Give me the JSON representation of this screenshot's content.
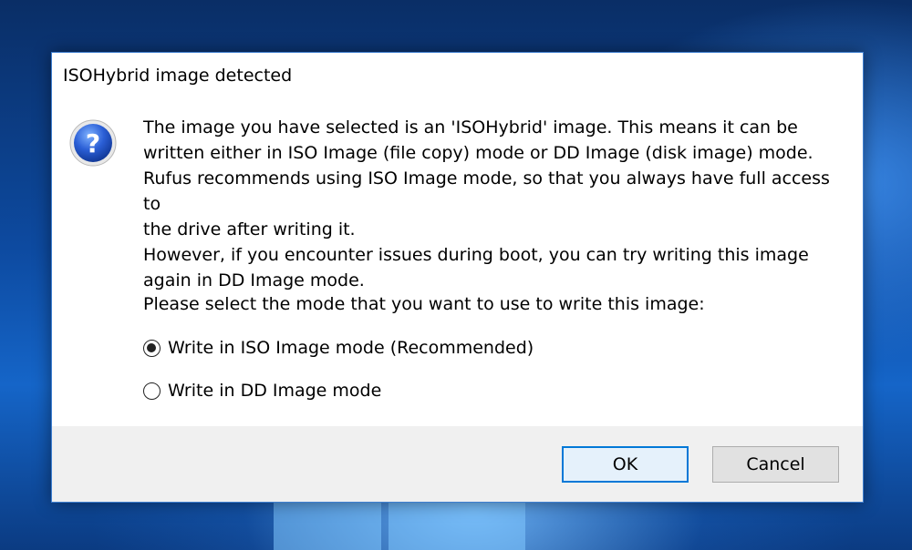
{
  "dialog": {
    "title": "ISOHybrid image detected",
    "icon": "question-icon",
    "message_lines": [
      "The image you have selected is an 'ISOHybrid' image. This means it can be",
      "written either in ISO Image (file copy) mode or DD Image (disk image) mode.",
      "Rufus recommends using ISO Image mode, so that you always have full access to",
      "the drive after writing it.",
      "However, if you encounter issues during boot, you can try writing this image",
      "again in DD Image mode."
    ],
    "prompt": "Please select the mode that you want to use to write this image:",
    "options": [
      {
        "label": "Write in ISO Image mode (Recommended)",
        "selected": true
      },
      {
        "label": "Write in DD Image mode",
        "selected": false
      }
    ],
    "buttons": {
      "ok": "OK",
      "cancel": "Cancel"
    }
  },
  "colors": {
    "accent": "#0078d7",
    "footer_bg": "#f0f0f0"
  }
}
